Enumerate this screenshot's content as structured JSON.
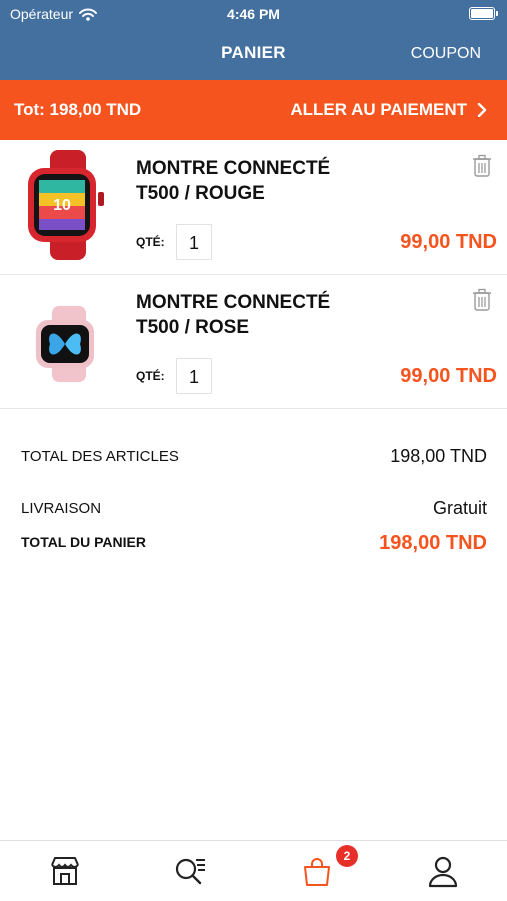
{
  "status_bar": {
    "carrier": "Opérateur",
    "time": "4:46 PM"
  },
  "header": {
    "title": "PANIER",
    "coupon_label": "COUPON"
  },
  "checkout": {
    "total_label": "Tot: 198,00 TND",
    "pay_label": "ALLER AU PAIEMENT"
  },
  "cart_items": [
    {
      "name_line1": "MONTRE CONNECTÉ",
      "name_line2": "T500 / ROUGE",
      "qty_label": "QTÉ:",
      "qty": "1",
      "price": "99,00 TND",
      "color": "#d8262e"
    },
    {
      "name_line1": "MONTRE CONNECTÉ",
      "name_line2": "T500 / ROSE",
      "qty_label": "QTÉ:",
      "qty": "1",
      "price": "99,00 TND",
      "color": "#f1c4cb"
    }
  ],
  "summary": {
    "articles_label": "TOTAL DES ARTICLES",
    "articles_value": "198,00 TND",
    "delivery_label": "LIVRAISON",
    "delivery_value": "Gratuit",
    "cart_total_label": "TOTAL DU PANIER",
    "cart_total_value": "198,00 TND"
  },
  "tab_bar": {
    "items": [
      "store-icon",
      "search-icon",
      "shopping-bag-icon",
      "user-icon"
    ],
    "active": "shopping-bag-icon",
    "cart_badge": "2"
  },
  "colors": {
    "header": "#44709f",
    "accent": "#f6541f",
    "badge": "#e8302a"
  }
}
